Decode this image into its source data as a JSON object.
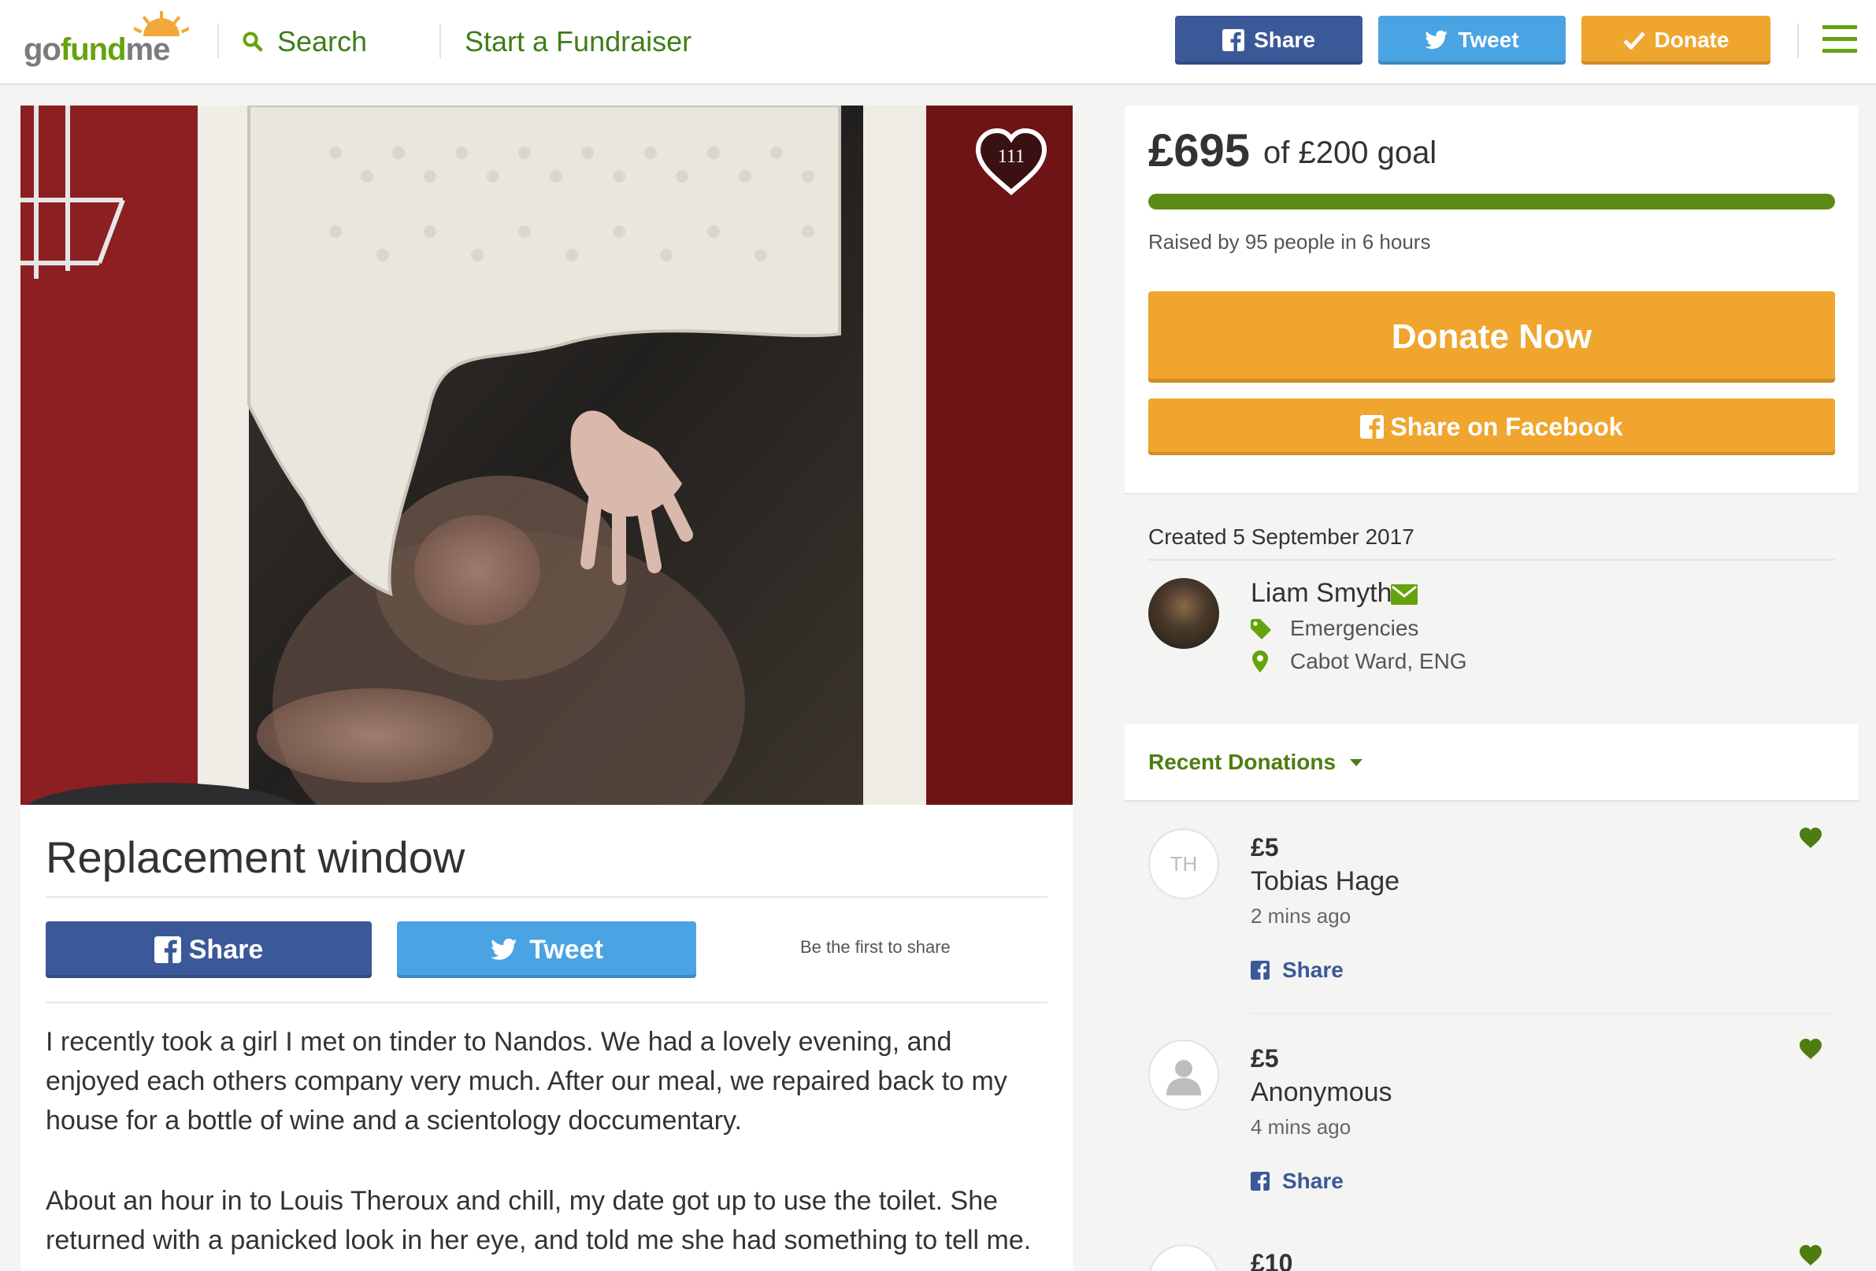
{
  "header": {
    "logo": "gofundme",
    "search_label": "Search",
    "start_label": "Start a Fundraiser",
    "share_label": "Share",
    "tweet_label": "Tweet",
    "donate_label": "Donate"
  },
  "campaign": {
    "heart_count": "111",
    "title": "Replacement window",
    "share_label": "Share",
    "tweet_label": "Tweet",
    "first_share": "Be the first to share",
    "story": [
      "I recently took a girl I met on tinder to Nandos. We had a lovely evening, and enjoyed each others company very much. After our meal, we repaired back to my house for a bottle of wine and a scientology doccumentary.",
      "About an hour in to Louis Theroux and chill, my date got up to use the toilet. She returned with a panicked look in her eye, and told me she had something to tell me."
    ]
  },
  "goal": {
    "raised": "£695",
    "of_goal": "of £200 goal",
    "progress_fraction": 1.0,
    "raised_by": "Raised by 95 people in 6 hours",
    "donate_now": "Donate Now",
    "share_facebook": "Share on Facebook"
  },
  "organizer": {
    "created": "Created 5 September 2017",
    "name": "Liam Smyth",
    "category": "Emergencies",
    "location": "Cabot Ward, ENG"
  },
  "recent": {
    "label": "Recent Donations",
    "donations": [
      {
        "initials": "TH",
        "amount": "£5",
        "name": "Tobias Hage",
        "time": "2 mins ago",
        "share": "Share"
      },
      {
        "initials": "",
        "amount": "£5",
        "name": "Anonymous",
        "time": "4 mins ago",
        "share": "Share"
      },
      {
        "initials": "",
        "amount": "£10",
        "name": "",
        "time": "",
        "share": ""
      }
    ]
  },
  "colors": {
    "brand_green": "#65a30d",
    "facebook_blue": "#3b5998",
    "twitter_blue": "#4aa3e2",
    "donate_orange": "#f0a52e",
    "progress_green": "#5c8a14"
  }
}
